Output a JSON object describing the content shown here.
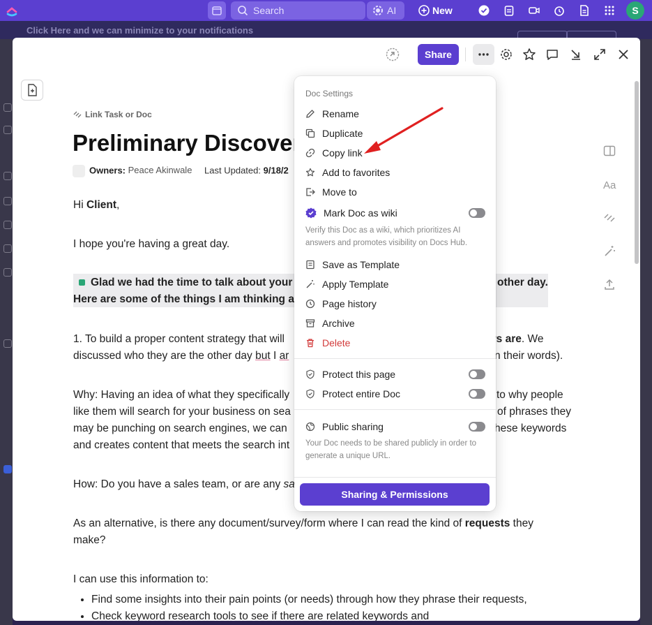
{
  "topbar": {
    "search_placeholder": "Search",
    "ai_label": "AI",
    "new_label": "New",
    "avatar_initial": "S"
  },
  "background": {
    "notice_text": "Click Here and we can minimize to your notifications"
  },
  "header": {
    "share_label": "Share"
  },
  "doc": {
    "link_task": "Link Task or Doc",
    "title": "Preliminary Discovery",
    "owners_label": "Owners:",
    "owner_name": "Peace Akinwale",
    "updated_label": "Last Updated:",
    "updated_value": "9/18/2",
    "greeting_pre": "Hi ",
    "greeting_bold": "Client",
    "greeting_post": ",",
    "p_hope": "I hope you're having a great day.",
    "hl_left_1": "Glad we had the time to talk about your",
    "hl_left_2": "Here are some of the things I am thinking a",
    "hl_right": "other day.",
    "p1_l1_a": "1. To build a proper content strategy that will",
    "p1_l1_b_bold": "ers are",
    "p1_l1_c": ". We",
    "p1_l2_a": "discussed who they are the other day ",
    "p1_l2_ul": "but",
    "p1_l2_b": " I ",
    "p1_l2_ul2": "ar",
    "p1_l2_c": "n their words).",
    "why_l1_a": "Why: Having an idea of what they specifically",
    "why_l1_b": "to why people",
    "why_l2_a": "like them will search for your business on sea",
    "why_l2_b": "of phrases they",
    "why_l3_a": "may be punching on search engines, we can",
    "why_l3_b": "hese keywords",
    "why_l4": "and creates content that meets the search int",
    "how_a": "How: Do you have a sales team, or are any ",
    "how_italic": "sa",
    "alt_l1_a": "As an alternative, is there any document/survey/form where I can read the kind of ",
    "alt_l1_bold": "requests",
    "alt_l1_b": " they",
    "alt_l2": "make?",
    "use_info": "I can use this information to:",
    "bullets": [
      "Find some insights into their pain points (or needs) through how they phrase their requests,",
      "Check keyword research tools to see if there are related keywords and"
    ]
  },
  "dropdown": {
    "heading": "Doc Settings",
    "items": {
      "rename": "Rename",
      "duplicate": "Duplicate",
      "copy_link": "Copy link",
      "add_favorites": "Add to favorites",
      "move_to": "Move to",
      "mark_wiki": "Mark Doc as wiki",
      "wiki_desc": "Verify this Doc as a wiki, which prioritizes AI answers and promotes visibility on Docs Hub.",
      "save_template": "Save as Template",
      "apply_template": "Apply Template",
      "page_history": "Page history",
      "archive": "Archive",
      "delete": "Delete",
      "protect_page": "Protect this page",
      "protect_doc": "Protect entire Doc",
      "public_sharing": "Public sharing",
      "public_desc": "Your Doc needs to be shared publicly in order to generate a unique URL.",
      "sharing_permissions": "Sharing & Permissions"
    }
  },
  "colors": {
    "brand": "#5b3fd0",
    "delete": "#d23a3a",
    "annotation_arrow": "#e02020"
  }
}
